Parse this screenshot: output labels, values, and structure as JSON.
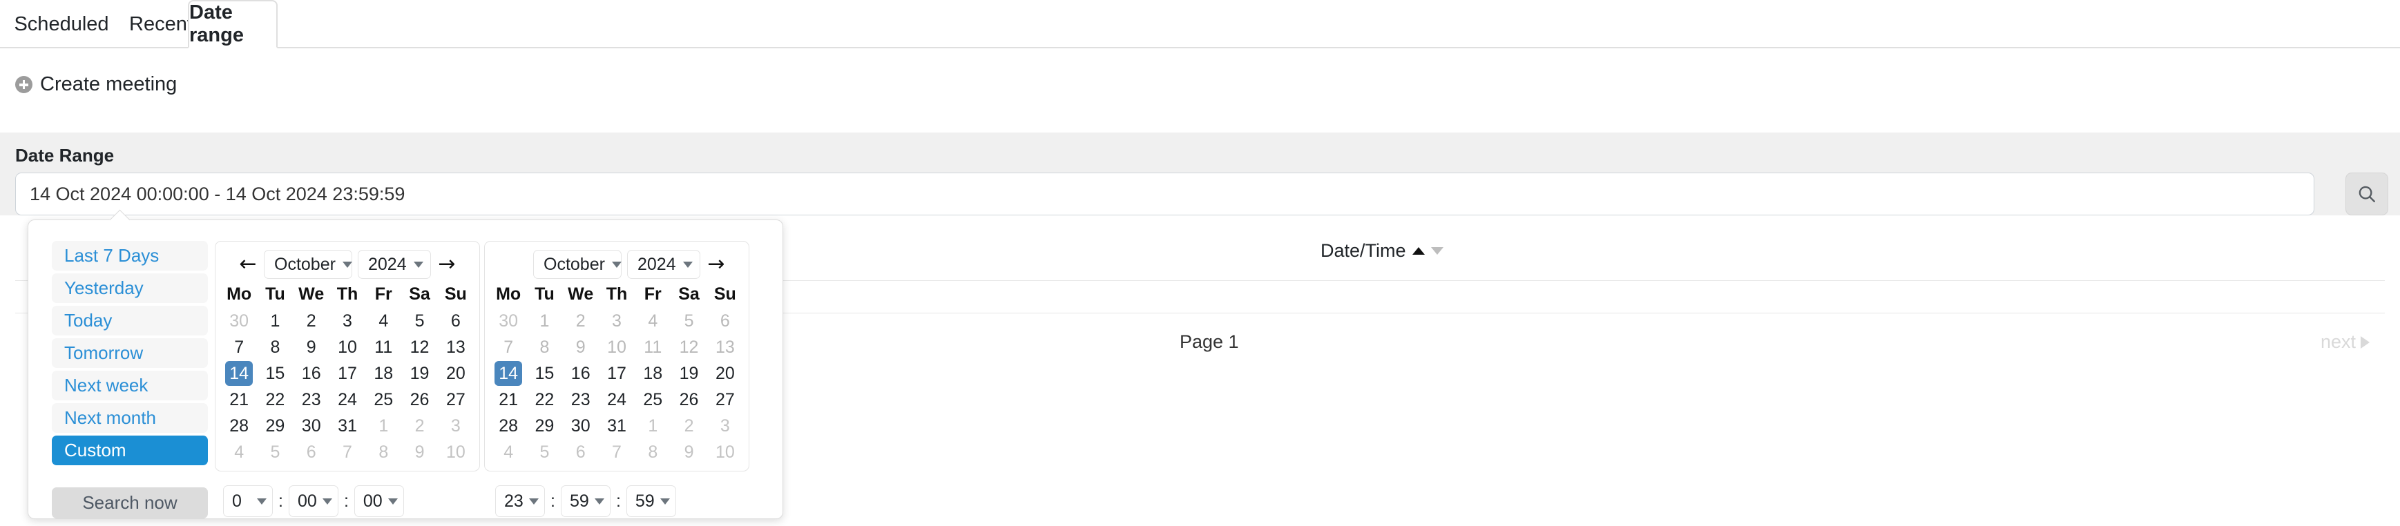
{
  "tabs": [
    {
      "label": "Scheduled",
      "active": false
    },
    {
      "label": "Recent",
      "active": false
    },
    {
      "label": "Date range",
      "active": true
    }
  ],
  "create_meeting": {
    "label": "Create meeting",
    "icon": "plus-circle-icon"
  },
  "search_band": {
    "label": "Date Range",
    "input_value": "14 Oct 2024 00:00:00 - 14 Oct 2024 23:59:59",
    "input_placeholder": "Date Range",
    "submit_icon": "search-icon"
  },
  "results": {
    "column_header": "Date/Time",
    "sort_asc_icon": "caret-up-icon",
    "sort_desc_icon": "caret-down-icon",
    "page_indicator": "Page 1",
    "next_label": "next"
  },
  "datepicker": {
    "presets": [
      {
        "label": "Last 7 Days",
        "selected": false
      },
      {
        "label": "Yesterday",
        "selected": false
      },
      {
        "label": "Today",
        "selected": false
      },
      {
        "label": "Tomorrow",
        "selected": false
      },
      {
        "label": "Next week",
        "selected": false
      },
      {
        "label": "Next month",
        "selected": false
      },
      {
        "label": "Custom",
        "selected": true
      }
    ],
    "search_now_label": "Search now",
    "weekdays": [
      "Mo",
      "Tu",
      "We",
      "Th",
      "Fr",
      "Sa",
      "Su"
    ],
    "calendars": [
      {
        "month": "October",
        "year": "2024",
        "prev_arrow": "←",
        "next_arrow": "→",
        "show_prev": true,
        "weeks": [
          [
            {
              "d": "30",
              "s": "muted"
            },
            {
              "d": "1",
              "s": ""
            },
            {
              "d": "2",
              "s": ""
            },
            {
              "d": "3",
              "s": ""
            },
            {
              "d": "4",
              "s": ""
            },
            {
              "d": "5",
              "s": ""
            },
            {
              "d": "6",
              "s": ""
            }
          ],
          [
            {
              "d": "7",
              "s": ""
            },
            {
              "d": "8",
              "s": ""
            },
            {
              "d": "9",
              "s": ""
            },
            {
              "d": "10",
              "s": ""
            },
            {
              "d": "11",
              "s": ""
            },
            {
              "d": "12",
              "s": ""
            },
            {
              "d": "13",
              "s": ""
            }
          ],
          [
            {
              "d": "14",
              "s": "selected"
            },
            {
              "d": "15",
              "s": ""
            },
            {
              "d": "16",
              "s": ""
            },
            {
              "d": "17",
              "s": ""
            },
            {
              "d": "18",
              "s": ""
            },
            {
              "d": "19",
              "s": ""
            },
            {
              "d": "20",
              "s": ""
            }
          ],
          [
            {
              "d": "21",
              "s": ""
            },
            {
              "d": "22",
              "s": ""
            },
            {
              "d": "23",
              "s": ""
            },
            {
              "d": "24",
              "s": ""
            },
            {
              "d": "25",
              "s": ""
            },
            {
              "d": "26",
              "s": ""
            },
            {
              "d": "27",
              "s": ""
            }
          ],
          [
            {
              "d": "28",
              "s": ""
            },
            {
              "d": "29",
              "s": ""
            },
            {
              "d": "30",
              "s": ""
            },
            {
              "d": "31",
              "s": ""
            },
            {
              "d": "1",
              "s": "muted"
            },
            {
              "d": "2",
              "s": "muted"
            },
            {
              "d": "3",
              "s": "muted"
            }
          ],
          [
            {
              "d": "4",
              "s": "muted"
            },
            {
              "d": "5",
              "s": "muted"
            },
            {
              "d": "6",
              "s": "muted"
            },
            {
              "d": "7",
              "s": "muted"
            },
            {
              "d": "8",
              "s": "muted"
            },
            {
              "d": "9",
              "s": "muted"
            },
            {
              "d": "10",
              "s": "muted"
            }
          ]
        ],
        "time": {
          "hour": "0",
          "minute": "00",
          "second": "00"
        }
      },
      {
        "month": "October",
        "year": "2024",
        "prev_arrow": "←",
        "next_arrow": "→",
        "show_prev": false,
        "weeks": [
          [
            {
              "d": "30",
              "s": "muted"
            },
            {
              "d": "1",
              "s": "disabled"
            },
            {
              "d": "2",
              "s": "disabled"
            },
            {
              "d": "3",
              "s": "disabled"
            },
            {
              "d": "4",
              "s": "disabled"
            },
            {
              "d": "5",
              "s": "disabled"
            },
            {
              "d": "6",
              "s": "disabled"
            }
          ],
          [
            {
              "d": "7",
              "s": "disabled"
            },
            {
              "d": "8",
              "s": "disabled"
            },
            {
              "d": "9",
              "s": "disabled"
            },
            {
              "d": "10",
              "s": "disabled"
            },
            {
              "d": "11",
              "s": "disabled"
            },
            {
              "d": "12",
              "s": "disabled"
            },
            {
              "d": "13",
              "s": "disabled"
            }
          ],
          [
            {
              "d": "14",
              "s": "selected"
            },
            {
              "d": "15",
              "s": ""
            },
            {
              "d": "16",
              "s": ""
            },
            {
              "d": "17",
              "s": ""
            },
            {
              "d": "18",
              "s": ""
            },
            {
              "d": "19",
              "s": ""
            },
            {
              "d": "20",
              "s": ""
            }
          ],
          [
            {
              "d": "21",
              "s": ""
            },
            {
              "d": "22",
              "s": ""
            },
            {
              "d": "23",
              "s": ""
            },
            {
              "d": "24",
              "s": ""
            },
            {
              "d": "25",
              "s": ""
            },
            {
              "d": "26",
              "s": ""
            },
            {
              "d": "27",
              "s": ""
            }
          ],
          [
            {
              "d": "28",
              "s": ""
            },
            {
              "d": "29",
              "s": ""
            },
            {
              "d": "30",
              "s": ""
            },
            {
              "d": "31",
              "s": ""
            },
            {
              "d": "1",
              "s": "muted"
            },
            {
              "d": "2",
              "s": "muted"
            },
            {
              "d": "3",
              "s": "muted"
            }
          ],
          [
            {
              "d": "4",
              "s": "muted"
            },
            {
              "d": "5",
              "s": "muted"
            },
            {
              "d": "6",
              "s": "muted"
            },
            {
              "d": "7",
              "s": "muted"
            },
            {
              "d": "8",
              "s": "muted"
            },
            {
              "d": "9",
              "s": "muted"
            },
            {
              "d": "10",
              "s": "muted"
            }
          ]
        ],
        "time": {
          "hour": "23",
          "minute": "59",
          "second": "59"
        }
      }
    ],
    "time_colon": ":"
  },
  "colors": {
    "accent": "#1b8fd4",
    "selected_day": "#4a86bd",
    "band": "#f0f0f0",
    "preset_bg": "#f6f6f6",
    "muted_text": "#c3c3c3"
  }
}
